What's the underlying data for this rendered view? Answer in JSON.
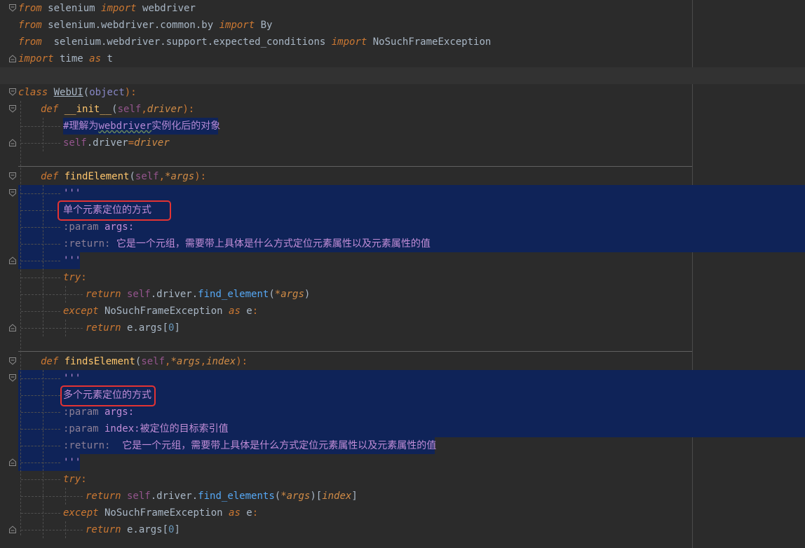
{
  "editor": {
    "language": "python",
    "accent_selection": "#0f2358",
    "highlight_box_color": "#e33333"
  },
  "lines": {
    "l1": {
      "kw": "from",
      "mod": " selenium ",
      "kw2": "import",
      "name": " webdriver"
    },
    "l2": {
      "kw": "from",
      "mod": " selenium.webdriver.common.by ",
      "kw2": "import",
      "name": " By"
    },
    "l3": {
      "kw": "from",
      "mod": "  selenium.webdriver.support.expected_conditions ",
      "kw2": "import",
      "name": " NoSuchFrameException"
    },
    "l4": {
      "kw": "import",
      "mod": " time ",
      "kw2": "as",
      "name": " t"
    },
    "l6": {
      "kw": "class",
      "name": "WebUI",
      "open": "(",
      "base": "object",
      "close": "):"
    },
    "l7": {
      "kw": "def",
      "name": "__init__",
      "open": "(",
      "self": "self",
      "comma": ",",
      "param": "driver",
      "close": "):"
    },
    "l8": {
      "hash": "#",
      "text1": "理解为",
      "word": "webdriver",
      "text2": "实例化后的对象"
    },
    "l9": {
      "self": "self",
      "attr": ".driver",
      "eq": "=",
      "param": "driver"
    },
    "l11": {
      "kw": "def",
      "name": "findElement",
      "open": "(",
      "self": "self",
      "comma": ",",
      "param": "*args",
      "close": "):"
    },
    "l12": {
      "text": "'''"
    },
    "l13": {
      "text": "单个元素定位的方式"
    },
    "l14": {
      "tag": ":param",
      "name": " args",
      "colon": ":"
    },
    "l15": {
      "tag": ":return:",
      "text": " 它是一个元组，需要带上具体是什么方式定位元素属性以及元素属性的值"
    },
    "l16": {
      "text": "'''"
    },
    "l17": {
      "kw": "try",
      "colon": ":"
    },
    "l18": {
      "kw": "return",
      "self": " self",
      "call": ".driver.",
      "fn": "find_element",
      "open": "(",
      "param": "*args",
      "close": ")"
    },
    "l19": {
      "kw": "except",
      "exc": " NoSuchFrameException ",
      "kw2": "as",
      "name": " e",
      "colon": ":"
    },
    "l20": {
      "kw": "return",
      "expr": " e.args[",
      "num": "0",
      "close": "]"
    },
    "l22": {
      "kw": "def",
      "name": "findsElement",
      "open": "(",
      "self": "self",
      "comma": ",",
      "param": "*args",
      "comma2": ",",
      "param2": "index",
      "close": "):"
    },
    "l23": {
      "text": "'''"
    },
    "l24": {
      "text": "多个元素定位的方式"
    },
    "l25": {
      "tag": ":param",
      "name": " args",
      "colon": ":"
    },
    "l26": {
      "tag": ":param",
      "name": " index",
      "text": ":被定位的目标索引值"
    },
    "l27": {
      "tag": ":return:",
      "text": "  它是一个元组，需要带上具体是什么方式定位元素属性以及元素属性的值"
    },
    "l28": {
      "text": "'''"
    },
    "l29": {
      "kw": "try",
      "colon": ":"
    },
    "l30": {
      "kw": "return",
      "self": " self",
      "call": ".driver.",
      "fn": "find_elements",
      "open": "(",
      "param": "*args",
      "close": ")[",
      "param2": "index",
      "close2": "]"
    },
    "l31": {
      "kw": "except",
      "exc": " NoSuchFrameException ",
      "kw2": "as",
      "name": " e",
      "colon": ":"
    },
    "l32": {
      "kw": "return",
      "expr": " e.args[",
      "num": "0",
      "close": "]"
    }
  }
}
